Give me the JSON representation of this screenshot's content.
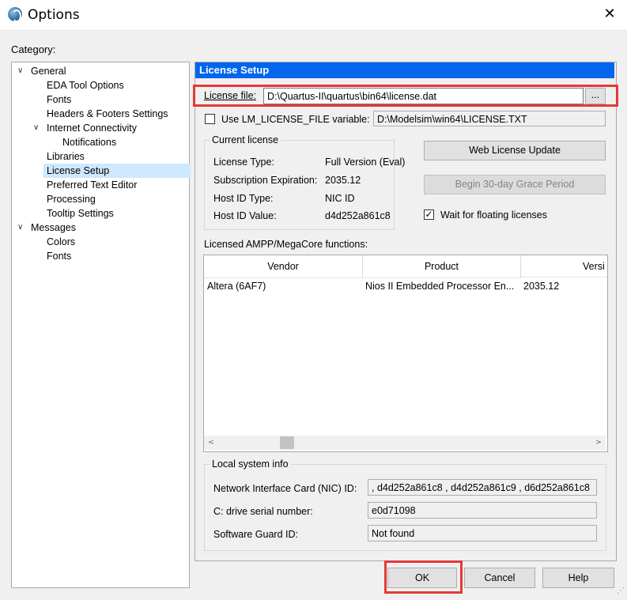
{
  "window": {
    "title": "Options",
    "close_glyph": "✕",
    "app_icon": "quartus-globe-icon"
  },
  "category_label": "Category:",
  "tree": [
    {
      "label": "General",
      "chevron": "∨"
    },
    {
      "label": "EDA Tool Options"
    },
    {
      "label": "Fonts"
    },
    {
      "label": "Headers & Footers Settings"
    },
    {
      "label": "Internet Connectivity",
      "chevron": "∨"
    },
    {
      "label": "Notifications"
    },
    {
      "label": "Libraries"
    },
    {
      "label": "License Setup",
      "selected": true
    },
    {
      "label": "Preferred Text Editor"
    },
    {
      "label": "Processing"
    },
    {
      "label": "Tooltip Settings"
    },
    {
      "label": "Messages",
      "chevron": "∨"
    },
    {
      "label": "Colors"
    },
    {
      "label": "Fonts"
    }
  ],
  "panel": {
    "title": "License Setup",
    "license_file": {
      "label": "License file:",
      "value": "D:\\Quartus-II\\quartus\\bin64\\license.dat",
      "browse": "..."
    },
    "lm_license": {
      "label": "Use LM_LICENSE_FILE variable:",
      "checked": false,
      "value": "D:\\Modelsim\\win64\\LICENSE.TXT"
    },
    "current_license": {
      "title": "Current license",
      "rows": [
        {
          "label": "License Type:",
          "value": "Full Version (Eval)"
        },
        {
          "label": "Subscription Expiration:",
          "value": "2035.12"
        },
        {
          "label": "Host ID Type:",
          "value": "NIC ID"
        },
        {
          "label": "Host ID Value:",
          "value": "d4d252a861c8"
        }
      ]
    },
    "web_license_update": "Web License Update",
    "grace_period": "Begin 30-day Grace Period",
    "wait_floating": {
      "label": "Wait for floating licenses",
      "checked": true,
      "check_glyph": "✓"
    },
    "functions": {
      "label": "Licensed AMPP/MegaCore functions:",
      "columns": [
        "Vendor",
        "Product",
        "Versi"
      ],
      "rows": [
        [
          "Altera (6AF7)",
          "Nios II Embedded Processor En...",
          "2035.12"
        ]
      ],
      "scroll_left": "<",
      "scroll_right": ">"
    },
    "local_info": {
      "title": "Local system info",
      "rows": [
        {
          "label": "Network Interface Card (NIC) ID:",
          "value": ", d4d252a861c8 , d4d252a861c9 , d6d252a861c8"
        },
        {
          "label": "C: drive serial number:",
          "value": "e0d71098"
        },
        {
          "label": "Software Guard ID:",
          "value": "Not found"
        }
      ]
    }
  },
  "buttons": {
    "ok": "OK",
    "cancel": "Cancel",
    "help": "Help"
  },
  "colors": {
    "header_blue": "#0066ee",
    "selection": "#cde8ff",
    "highlight_red": "#e53935"
  }
}
